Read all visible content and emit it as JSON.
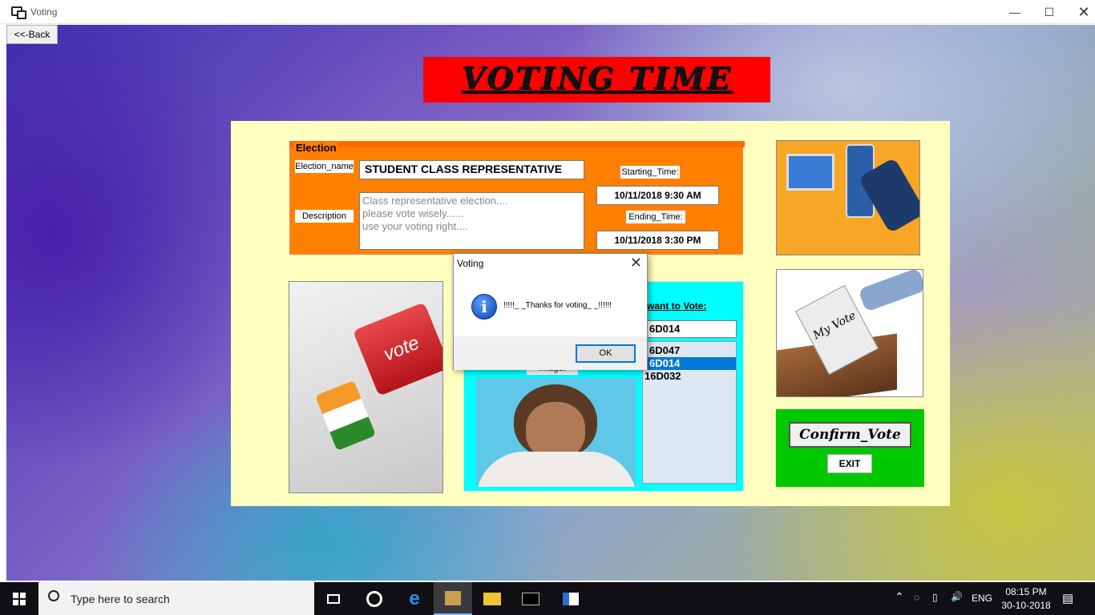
{
  "window": {
    "title": "Voting",
    "min_icon": "minimize-icon",
    "max_icon": "maximize-icon",
    "close_icon": "close-icon"
  },
  "app": {
    "back_label": "<<-Back",
    "banner_title": "VOTING  TIME",
    "election": {
      "legend": "Election",
      "name_label": "Election_name",
      "name_value": "STUDENT CLASS REPRESENTATIVE",
      "description_label": "Description",
      "description_lines": [
        "Class representative election....",
        "please vote wisely......",
        "use your voting right...."
      ],
      "start_label": "Starting_Time:",
      "start_value": "10/11/2018 9:30 AM",
      "end_label": "Ending_Time:",
      "end_value": "10/11/2018 3:30 PM"
    },
    "candidate": {
      "want_label": "want to Vote:",
      "selected_value": "6D014",
      "options": [
        "6D047",
        "6D014",
        "16D032"
      ],
      "selected_index": 1,
      "image_label": "Image:"
    },
    "confirm_label": "Confirm_Vote",
    "exit_label": "EXIT",
    "colors": {
      "banner": "#ff0000",
      "panel": "#ffffc0",
      "election": "#ff8000",
      "photo_panel": "#00ffff",
      "confirm_panel": "#00c800"
    }
  },
  "dialog": {
    "title": "Voting",
    "message": "!!!!!_ _Thanks for voting_ _!!!!!!",
    "ok_label": "OK",
    "icon": "info-icon"
  },
  "taskbar": {
    "search_placeholder": "Type here to search",
    "language": "ENG",
    "time": "08:15 PM",
    "date": "30-10-2018"
  }
}
